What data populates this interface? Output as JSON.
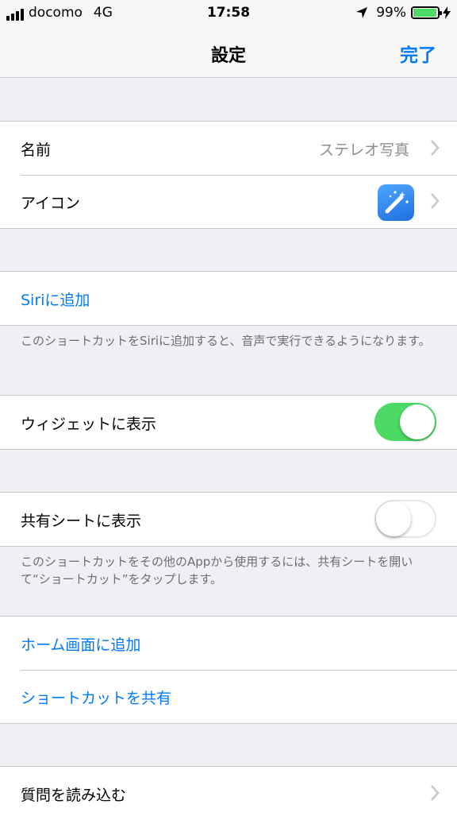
{
  "status_bar": {
    "carrier": "docomo",
    "network": "4G",
    "time": "17:58",
    "battery": "99%"
  },
  "nav": {
    "title": "設定",
    "done": "完了"
  },
  "section1": {
    "name_label": "名前",
    "name_value": "ステレオ写真",
    "icon_label": "アイコン"
  },
  "siri": {
    "add_label": "Siriに追加",
    "footer": "このショートカットをSiriに追加すると、音声で実行できるようになります。"
  },
  "widget": {
    "label": "ウィジェットに表示",
    "enabled": true
  },
  "share_sheet": {
    "label": "共有シートに表示",
    "enabled": false,
    "footer": "このショートカットをその他のAppから使用するには、共有シートを開いて“ショートカット”をタップします。"
  },
  "actions": {
    "home_screen": "ホーム画面に追加",
    "share": "ショートカットを共有"
  },
  "import": {
    "label": "質問を読み込む"
  },
  "colors": {
    "accent": "#007aff",
    "toggle_on": "#4cd964",
    "background": "#efeff4"
  },
  "icons": [
    "location-arrow-icon",
    "battery-icon",
    "chevron-right-icon",
    "magic-wand-icon"
  ]
}
